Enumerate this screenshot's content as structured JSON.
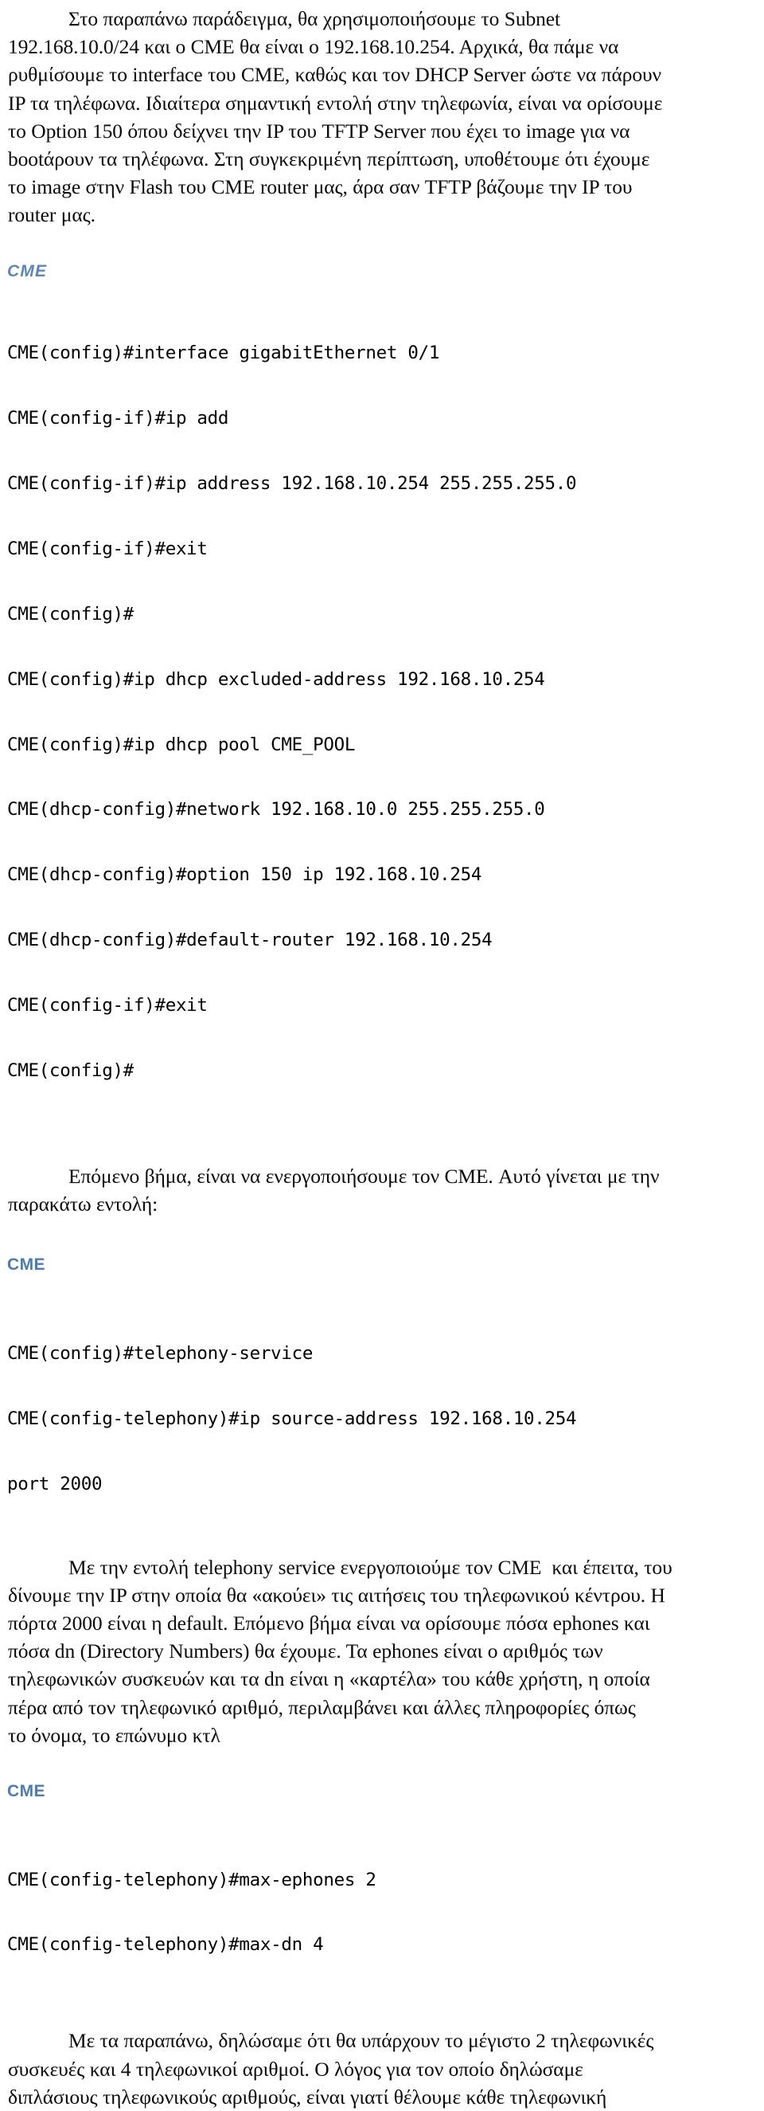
{
  "document": {
    "language": "el",
    "accent_color": "#4b7cb5",
    "body_color": "#0a0a0a"
  },
  "blocks": {
    "para_intro": "Στο παραπάνω παράδειγμα, θα χρησιμοποιήσουμε το Subnet\n192.168.10.0/24 και ο CME θα είναι ο 192.168.10.254. Αρχικά, θα πάμε να\nρυθμίσουμε το interface του CME, καθώς και τον DHCP Server ώστε να πάρουν\nIP τα τηλέφωνα. Ιδιαίτερα σημαντική εντολή στην τηλεφωνία, είναι να ορίσουμε\nτο Option 150 όπου δείχνει την IP του TFTP Server που έχει το image για να\nbootάρουν τα τηλέφωνα. Στη συγκεκριμένη περίπτωση, υποθέτουμε ότι έχουμε\nτο image στην Flash του CME router μας, άρα σαν TFTP βάζουμε την IP του\nrouter μας.",
    "para_next_step": "Επόμενο βήμα, είναι να ενεργοποιήσουμε τον CME. Αυτό γίνεται με την\nπαρακάτω εντολή:",
    "para_telephony": "Με την εντολή telephony service ενεργοποιούμε τον CME  και έπειτα, του\nδίνουμε την IP στην οποία θα «ακούει» τις αιτήσεις του τηλεφωνικού κέντρου. Η\nπόρτα 2000 είναι η default. Επόμενο βήμα είναι να ορίσουμε πόσα ephones και\nπόσα dn (Directory Numbers) θα έχουμε. Τα ephones είναι ο αριθμός των\nτηλεφωνικών συσκευών και τα dn είναι η «καρτέλα» του κάθε χρήστη, η οποία\nπέρα από τον τηλεφωνικό αριθμό, περιλαμβάνει και άλλες πληροφορίες όπως\nτο όνομα, το επώνυμο κτλ",
    "para_conclusion": "Με τα παραπάνω, δηλώσαμε ότι θα υπάρχουν το μέγιστο 2 τηλεφωνικές\nσυσκευές και 4 τηλεφωνικοί αριθμοί. Ο λόγος για τον οποίο δηλώσαμε\nδιπλάσιους τηλεφωνικούς αριθμούς, είναι γιατί θέλουμε κάθε τηλεφωνική"
  },
  "code_blocks": [
    {
      "label": "CME",
      "label_style": "italic",
      "lines": [
        "CME(config)#interface gigabitEthernet 0/1",
        "CME(config-if)#ip add",
        "CME(config-if)#ip address 192.168.10.254 255.255.255.0",
        "CME(config-if)#exit",
        "CME(config)#",
        "CME(config)#ip dhcp excluded-address 192.168.10.254",
        "CME(config)#ip dhcp pool CME_POOL",
        "CME(dhcp-config)#network 192.168.10.0 255.255.255.0",
        "CME(dhcp-config)#option 150 ip 192.168.10.254",
        "CME(dhcp-config)#default-router 192.168.10.254",
        "CME(config-if)#exit",
        "CME(config)#"
      ]
    },
    {
      "label": "CME",
      "label_style": "bold",
      "lines": [
        "CME(config)#telephony-service",
        "CME(config-telephony)#ip source-address 192.168.10.254",
        "port 2000"
      ]
    },
    {
      "label": "CME",
      "label_style": "bold",
      "lines": [
        "CME(config-telephony)#max-ephones 2",
        "CME(config-telephony)#max-dn 4"
      ]
    }
  ]
}
